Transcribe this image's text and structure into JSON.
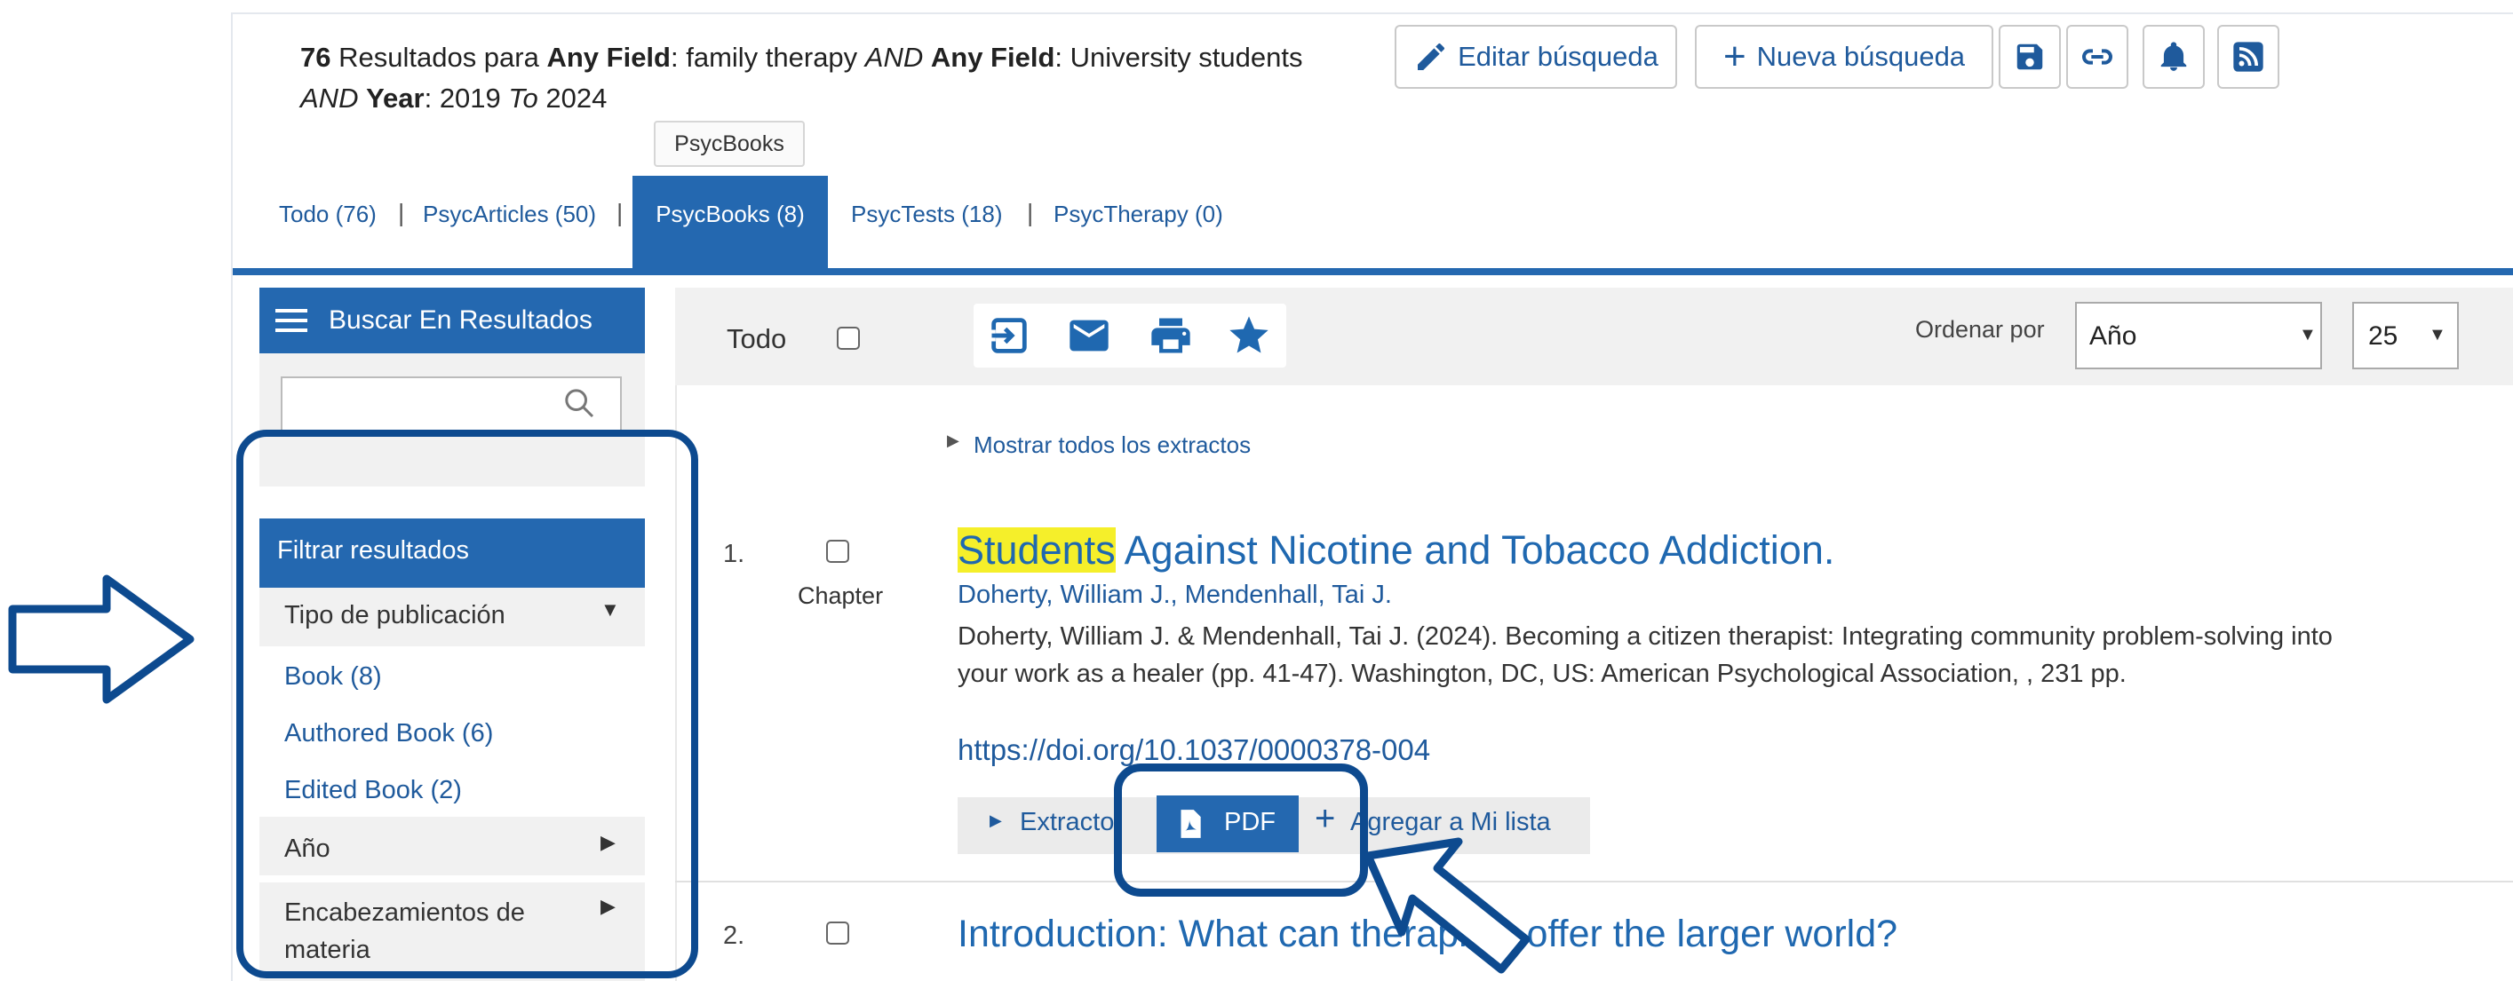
{
  "search_summary": {
    "count": "76",
    "text_resultados_para": " Resultados para ",
    "field1": "Any Field",
    "query1": ": family therapy ",
    "op1": "AND",
    "field2": "Any Field",
    "query2": ": University students",
    "op2": "AND",
    "field3": "Year",
    "range_from": ": 2019 ",
    "range_to_word": "To",
    "range_to": " 2024"
  },
  "toolbar": {
    "edit_search": "Editar búsqueda",
    "new_search": "Nueva búsqueda",
    "icons": [
      "save-icon",
      "link-icon",
      "bell-icon",
      "rss-icon"
    ]
  },
  "tooltip": "PsycBooks",
  "tabs": [
    {
      "label": "Todo (76)",
      "active": false
    },
    {
      "label": "PsycArticles (50)",
      "active": false
    },
    {
      "label": "PsycBooks (8)",
      "active": true
    },
    {
      "label": "PsycTests (18)",
      "active": false
    },
    {
      "label": "PsycTherapy (0)",
      "active": false
    }
  ],
  "tab_separator": "|",
  "sidebar": {
    "search_in_results": "Buscar En Resultados",
    "filter_header": "Filtrar resultados",
    "publication_type_label": "Tipo de publicación",
    "publication_types": [
      "Book (8)",
      "Authored Book (6)",
      "Edited Book (2)"
    ],
    "year_label": "Año",
    "subject_label": "Encabezamientos de",
    "subject_label_2": "materia"
  },
  "results_bar": {
    "select_all_label": "Todo",
    "action_icons": [
      "export-icon",
      "email-icon",
      "print-icon",
      "star-icon"
    ],
    "sort_label": "Ordenar por",
    "sort_value": "Año",
    "per_page_value": "25"
  },
  "show_all_extracts": "Mostrar todos los extractos",
  "results": [
    {
      "number": "1.",
      "type": "Chapter",
      "title_highlight": "Students",
      "title_rest": " Against Nicotine and Tobacco Addiction.",
      "authors": "Doherty, William J., Mendenhall, Tai J.",
      "citation": "Doherty, William J. & Mendenhall, Tai J. (2024). Becoming a citizen therapist: Integrating community problem-solving into your work as a healer (pp. 41-47). Washington, DC, US: American Psychological Association, , 231 pp.",
      "doi": "https://doi.org/10.1037/0000378-004",
      "actions": {
        "extract": "Extracto",
        "pdf": "PDF",
        "add_list": "Agregar a Mi lista"
      }
    },
    {
      "number": "2.",
      "title": "Introduction: What can therapists offer the larger world?"
    }
  ],
  "colors": {
    "primary_blue": "#2468b0",
    "link_blue": "#1f68b0",
    "highlight_yellow": "#f5ef2a",
    "annotation_blue": "#0d4a8f"
  }
}
